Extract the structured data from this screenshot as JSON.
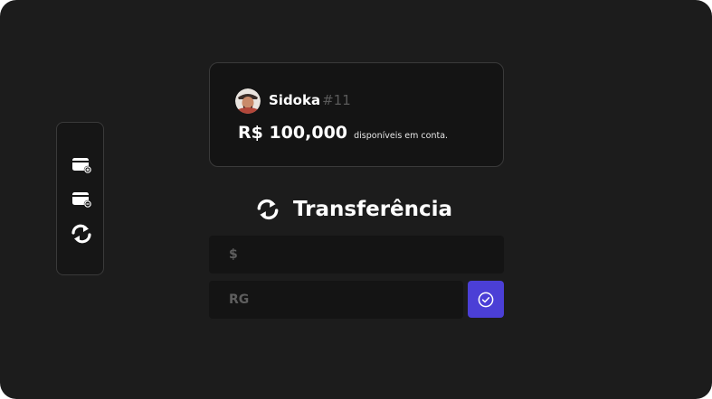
{
  "account": {
    "username": "Sidoka",
    "user_id": "#11",
    "balance": "R$ 100,000",
    "balance_suffix": "disponíveis em conta."
  },
  "transfer": {
    "title": "Transferência",
    "amount_placeholder": "$",
    "rg_placeholder": "RG"
  },
  "sidebar": {
    "items": [
      {
        "icon": "wallet-deposit-icon"
      },
      {
        "icon": "wallet-withdraw-icon"
      },
      {
        "icon": "transfer-icon"
      }
    ]
  },
  "colors": {
    "background": "#1c1c1c",
    "card": "#141414",
    "border": "#3a3a3a",
    "accent": "#4b3fd6",
    "muted_text": "#5e5e5e"
  }
}
